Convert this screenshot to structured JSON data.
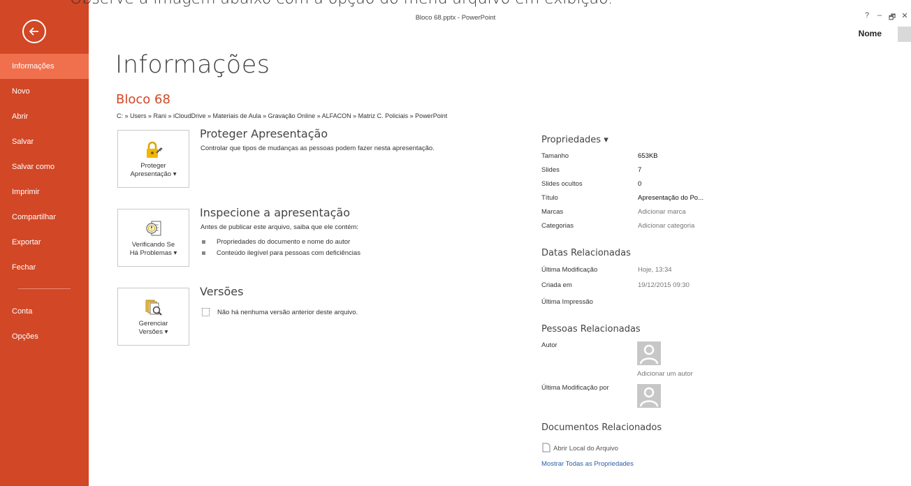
{
  "overlay_caption": "Observe a imagem abaixo com a opção do menu arquivo em exibição.",
  "window": {
    "title": "Bloco 68.pptx - PowerPoint",
    "help": "?",
    "minimize": "–",
    "restore": "🗗",
    "close": "✕",
    "user_name": "Nome"
  },
  "sidebar": {
    "items": [
      {
        "label": "Informações",
        "active": true
      },
      {
        "label": "Novo"
      },
      {
        "label": "Abrir"
      },
      {
        "label": "Salvar"
      },
      {
        "label": "Salvar como"
      },
      {
        "label": "Imprimir"
      },
      {
        "label": "Compartilhar"
      },
      {
        "label": "Exportar"
      },
      {
        "label": "Fechar"
      }
    ],
    "bottom_items": [
      {
        "label": "Conta"
      },
      {
        "label": "Opções"
      }
    ]
  },
  "main": {
    "title": "Informações",
    "doc_name": "Bloco 68",
    "path": "C: » Users » Rani » iCloudDrive » Materiais de Aula » Gravação Online » ALFACON » Matriz C. Policiais » PowerPoint",
    "protect": {
      "tile_line1": "Proteger",
      "tile_line2": "Apresentação ▾",
      "title": "Proteger Apresentação",
      "desc": "Controlar que tipos de mudanças as pessoas podem fazer nesta apresentação."
    },
    "inspect": {
      "tile_line1": "Verificando Se",
      "tile_line2": "Há Problemas ▾",
      "title": "Inspecione a apresentação",
      "desc": "Antes de publicar este arquivo, saiba que ele contém:",
      "bullets": [
        "Propriedades do documento e nome do autor",
        "Conteúdo ilegível para pessoas com deficiências"
      ]
    },
    "versions": {
      "tile_line1": "Gerenciar",
      "tile_line2": "Versões ▾",
      "title": "Versões",
      "desc": "Não há nenhuma versão anterior deste arquivo."
    }
  },
  "properties": {
    "header": "Propriedades ▾",
    "rows": [
      {
        "key": "Tamanho",
        "value": "653KB"
      },
      {
        "key": "Slides",
        "value": "7"
      },
      {
        "key": "Slides ocultos",
        "value": "0"
      },
      {
        "key": "Título",
        "value": "Apresentação do Po..."
      },
      {
        "key": "Marcas",
        "value": "Adicionar marca"
      },
      {
        "key": "Categorias",
        "value": "Adicionar categoria"
      }
    ]
  },
  "dates": {
    "header": "Datas Relacionadas",
    "rows": [
      {
        "key": "Última Modificação",
        "value": "Hoje, 13:34"
      },
      {
        "key": "Criada em",
        "value": "19/12/2015 09:30"
      },
      {
        "key": "Última Impressão",
        "value": ""
      }
    ]
  },
  "people": {
    "header": "Pessoas Relacionadas",
    "author_label": "Autor",
    "add_author": "Adicionar um autor",
    "last_modified_by": "Última Modificação por"
  },
  "related_docs": {
    "header": "Documentos Relacionados",
    "open_location": "Abrir Local do Arquivo",
    "show_all": "Mostrar Todas as Propriedades"
  }
}
